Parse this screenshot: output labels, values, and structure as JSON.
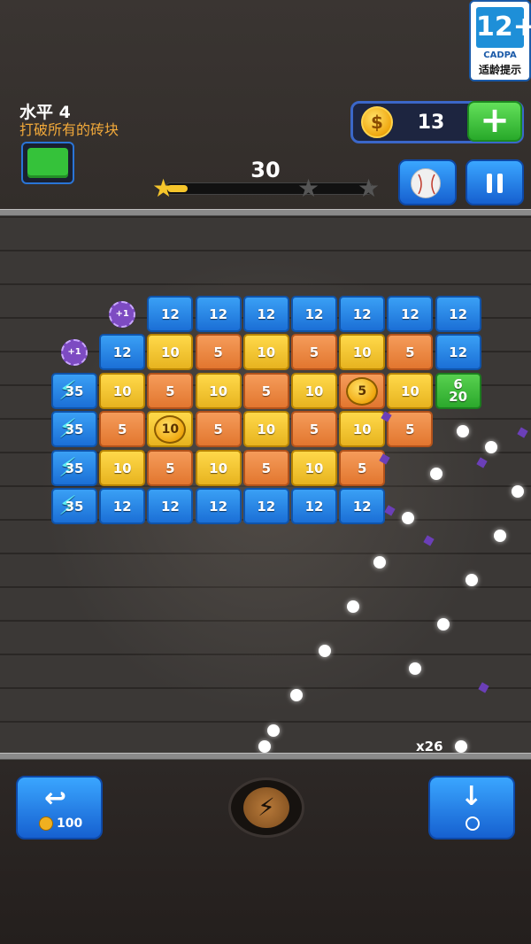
{
  "age_rating": {
    "number": "12+",
    "org": "CADPA",
    "tip": "适龄提示"
  },
  "level": {
    "title": "水平 4",
    "objective": "打破所有的砖块"
  },
  "coins": {
    "icon": "dollar-coin-icon",
    "count": "13",
    "add_label": "+"
  },
  "score": "30",
  "progress": {
    "fill_fraction": 0.1,
    "stars": [
      "earned",
      "empty",
      "empty"
    ]
  },
  "controls": {
    "ball_icon": "baseball-icon",
    "pause_icon": "pause-icon"
  },
  "bricks": [
    {
      "row": 0,
      "col": 2,
      "type": "blue",
      "label": "12"
    },
    {
      "row": 0,
      "col": 3,
      "type": "blue",
      "label": "12"
    },
    {
      "row": 0,
      "col": 4,
      "type": "blue",
      "label": "12"
    },
    {
      "row": 0,
      "col": 5,
      "type": "blue",
      "label": "12"
    },
    {
      "row": 0,
      "col": 6,
      "type": "blue",
      "label": "12"
    },
    {
      "row": 0,
      "col": 7,
      "type": "blue",
      "label": "12"
    },
    {
      "row": 0,
      "col": 8,
      "type": "blue",
      "label": "12"
    },
    {
      "row": 1,
      "col": 1,
      "type": "blue",
      "label": "12"
    },
    {
      "row": 1,
      "col": 2,
      "type": "yellow",
      "label": "10"
    },
    {
      "row": 1,
      "col": 3,
      "type": "orange",
      "label": "5"
    },
    {
      "row": 1,
      "col": 4,
      "type": "yellow",
      "label": "10"
    },
    {
      "row": 1,
      "col": 5,
      "type": "orange",
      "label": "5"
    },
    {
      "row": 1,
      "col": 6,
      "type": "yellow",
      "label": "10"
    },
    {
      "row": 1,
      "col": 7,
      "type": "orange",
      "label": "5"
    },
    {
      "row": 1,
      "col": 8,
      "type": "blue",
      "label": "12"
    },
    {
      "row": 2,
      "col": 0,
      "type": "bolt",
      "label": "35"
    },
    {
      "row": 2,
      "col": 1,
      "type": "yellow",
      "label": "10"
    },
    {
      "row": 2,
      "col": 2,
      "type": "orange",
      "label": "5"
    },
    {
      "row": 2,
      "col": 3,
      "type": "yellow",
      "label": "10"
    },
    {
      "row": 2,
      "col": 4,
      "type": "orange",
      "label": "5"
    },
    {
      "row": 2,
      "col": 5,
      "type": "yellow",
      "label": "10"
    },
    {
      "row": 2,
      "col": 6,
      "type": "coin-orange",
      "label": "5"
    },
    {
      "row": 2,
      "col": 7,
      "type": "yellow",
      "label": "10"
    },
    {
      "row": 2,
      "col": 8,
      "type": "green",
      "label": "6\n20"
    },
    {
      "row": 3,
      "col": 0,
      "type": "bolt",
      "label": "35"
    },
    {
      "row": 3,
      "col": 1,
      "type": "orange",
      "label": "5"
    },
    {
      "row": 3,
      "col": 2,
      "type": "coin-yellow",
      "label": "10"
    },
    {
      "row": 3,
      "col": 3,
      "type": "orange",
      "label": "5"
    },
    {
      "row": 3,
      "col": 4,
      "type": "yellow",
      "label": "10"
    },
    {
      "row": 3,
      "col": 5,
      "type": "orange",
      "label": "5"
    },
    {
      "row": 3,
      "col": 6,
      "type": "yellow",
      "label": "10"
    },
    {
      "row": 3,
      "col": 7,
      "type": "orange",
      "label": "5"
    },
    {
      "row": 4,
      "col": 0,
      "type": "bolt",
      "label": "35"
    },
    {
      "row": 4,
      "col": 1,
      "type": "yellow",
      "label": "10"
    },
    {
      "row": 4,
      "col": 2,
      "type": "orange",
      "label": "5"
    },
    {
      "row": 4,
      "col": 3,
      "type": "yellow",
      "label": "10"
    },
    {
      "row": 4,
      "col": 4,
      "type": "orange",
      "label": "5"
    },
    {
      "row": 4,
      "col": 5,
      "type": "yellow",
      "label": "10"
    },
    {
      "row": 4,
      "col": 6,
      "type": "orange",
      "label": "5"
    },
    {
      "row": 5,
      "col": 0,
      "type": "bolt",
      "label": "35"
    },
    {
      "row": 5,
      "col": 1,
      "type": "blue",
      "label": "12"
    },
    {
      "row": 5,
      "col": 2,
      "type": "blue",
      "label": "12"
    },
    {
      "row": 5,
      "col": 3,
      "type": "blue",
      "label": "12"
    },
    {
      "row": 5,
      "col": 4,
      "type": "blue",
      "label": "12"
    },
    {
      "row": 5,
      "col": 5,
      "type": "blue",
      "label": "12"
    },
    {
      "row": 5,
      "col": 6,
      "type": "blue",
      "label": "12"
    }
  ],
  "powerups": [
    {
      "row": 0,
      "col": 1,
      "label": "+1"
    },
    {
      "row": 1,
      "col": 0,
      "label": "+1"
    }
  ],
  "ball_count": "x26",
  "bottom": {
    "undo_cost": "100",
    "undo_icon": "undo-arrow-icon",
    "power_icon": "lightning-bolt-icon",
    "drop_icon": "drop-down-arrow-icon"
  }
}
